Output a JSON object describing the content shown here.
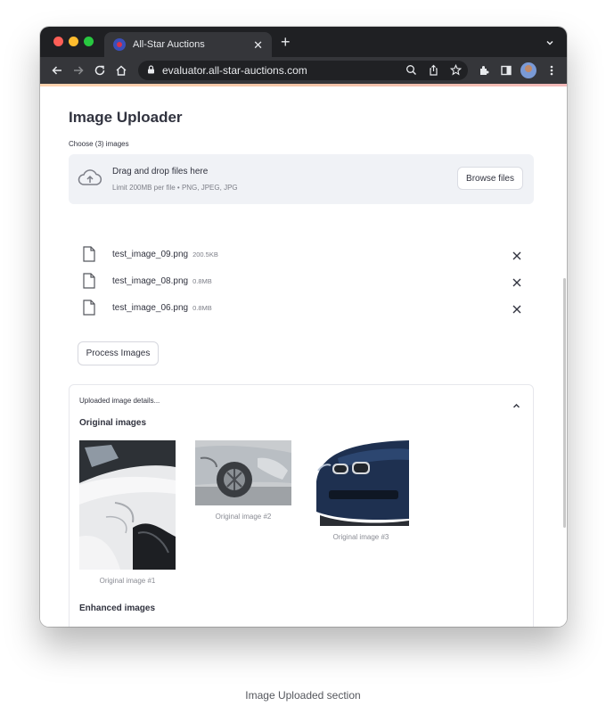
{
  "browser": {
    "tab_title": "All-Star Auctions",
    "url": "evaluator.all-star-auctions.com",
    "traffic_light_colors": [
      "#ff5f57",
      "#febc2e",
      "#28c840"
    ],
    "icons": [
      "back-arrow-icon",
      "forward-arrow-icon",
      "reload-icon",
      "home-icon",
      "lock-icon",
      "zoom-icon",
      "share-icon",
      "star-icon",
      "extensions-icon",
      "side-panel-icon",
      "avatar",
      "more-menu-icon"
    ]
  },
  "page": {
    "title": "Image Uploader",
    "uploader_label": "Choose (3) images",
    "dropzone": {
      "title": "Drag and drop files here",
      "limit": "Limit 200MB per file • PNG, JPEG, JPG",
      "browse_label": "Browse files"
    },
    "files": [
      {
        "name": "test_image_09.png",
        "size": "200.5KB"
      },
      {
        "name": "test_image_08.png",
        "size": "0.8MB"
      },
      {
        "name": "test_image_06.png",
        "size": "0.8MB"
      }
    ],
    "process_label": "Process Images",
    "expander": {
      "title": "Uploaded image details...",
      "original_heading": "Original images",
      "captions": [
        "Original image #1",
        "Original image #2",
        "Original image #3"
      ],
      "enhanced_heading": "Enhanced images"
    }
  },
  "footer_caption": "Image Uploaded section",
  "colors": {
    "text": "#31333f",
    "muted": "#7d7f88",
    "dropzone_bg": "#f0f2f6",
    "chrome_dark": "#1f2023",
    "chrome_toolbar": "#35363a"
  }
}
